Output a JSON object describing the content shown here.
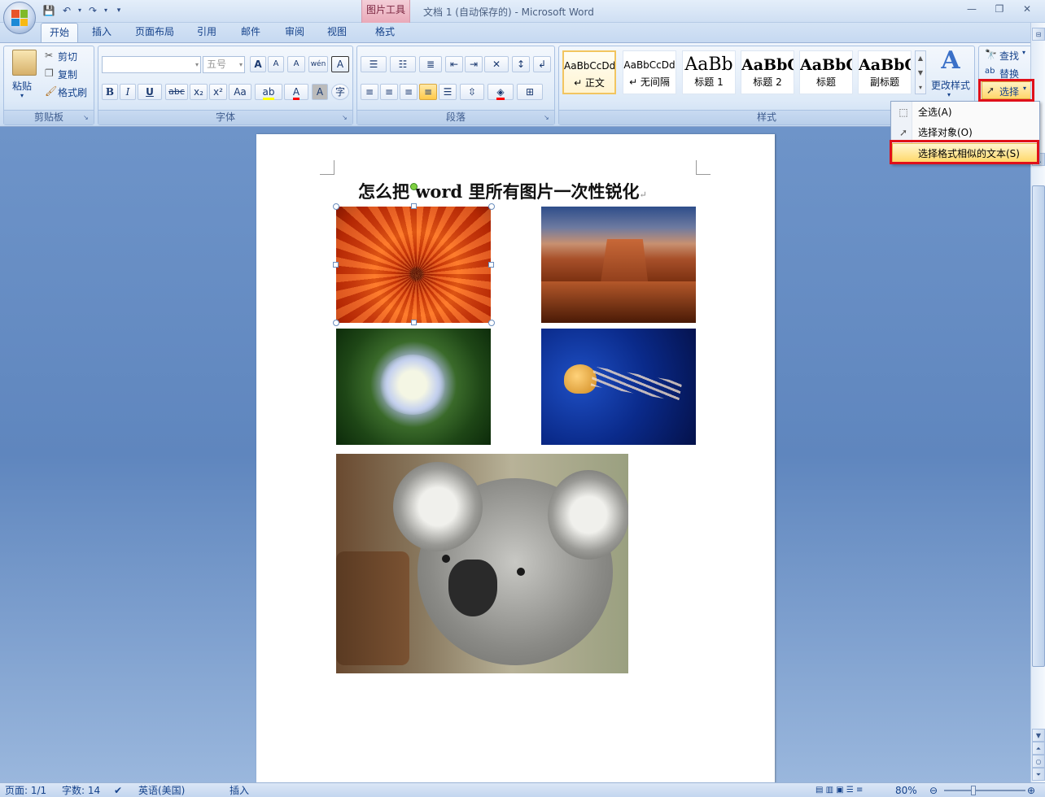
{
  "window": {
    "title": "文档 1 (自动保存的) - Microsoft Word",
    "contextual_tab_group": "图片工具",
    "controls": {
      "minimize": "—",
      "restore": "❐",
      "close": "✕"
    }
  },
  "quick_access": [
    "save-icon",
    "undo-icon",
    "redo-icon",
    "customize-icon"
  ],
  "tabs": [
    {
      "label": "开始",
      "active": true
    },
    {
      "label": "插入"
    },
    {
      "label": "页面布局"
    },
    {
      "label": "引用"
    },
    {
      "label": "邮件"
    },
    {
      "label": "审阅"
    },
    {
      "label": "视图"
    },
    {
      "label": "格式"
    }
  ],
  "clipboard": {
    "label": "剪贴板",
    "paste": "粘贴",
    "cut": "剪切",
    "copy": "复制",
    "format_painter": "格式刷"
  },
  "font": {
    "label": "字体",
    "font_name_value": "",
    "font_size_value": "五号",
    "bold": "B",
    "italic": "I",
    "underline": "U",
    "strike": "abc",
    "subscript": "x₂",
    "superscript": "x²",
    "change_case": "Aa",
    "grow": "A",
    "shrink": "A",
    "clear": "A",
    "phonetic": "wén",
    "border": "A",
    "color_font": "A",
    "shade": "A",
    "enclose": "字",
    "highlight_color": "#ffff00",
    "font_color": "#ff0000"
  },
  "paragraph": {
    "label": "段落"
  },
  "styles": {
    "label": "样式",
    "items": [
      {
        "preview": "AaBbCcDd",
        "name": "↵ 正文",
        "selected": true
      },
      {
        "preview": "AaBbCcDd",
        "name": "↵ 无间隔"
      },
      {
        "preview": "AaBb",
        "name": "标题 1"
      },
      {
        "preview": "AaBbC",
        "name": "标题 2"
      },
      {
        "preview": "AaBbC",
        "name": "标题"
      },
      {
        "preview": "AaBbC",
        "name": "副标题"
      }
    ],
    "change_styles": "更改样式"
  },
  "editing": {
    "find": "查找",
    "replace": "替换",
    "select": "选择"
  },
  "select_menu": {
    "items": [
      {
        "label": "全选(A)",
        "icon": "select-all-icon"
      },
      {
        "label": "选择对象(O)",
        "icon": "select-objects-icon"
      },
      {
        "label": "选择格式相似的文本(S)",
        "icon": "",
        "highlighted": true
      }
    ]
  },
  "document": {
    "title": "怎么把 word 里所有图片一次性锐化",
    "paragraph_mark": "↵",
    "images": [
      "flower-image",
      "desert-butte-image",
      "hydrangea-image",
      "jellyfish-image",
      "koala-image"
    ]
  },
  "status_bar": {
    "page": "页面: 1/1",
    "words": "字数: 14",
    "language": "英语(美国)",
    "mode": "插入",
    "zoom": "80%"
  },
  "colors": {
    "accent_red": "#e0101a",
    "ribbon_text": "#15428b",
    "highlight": "#ffd86b"
  }
}
